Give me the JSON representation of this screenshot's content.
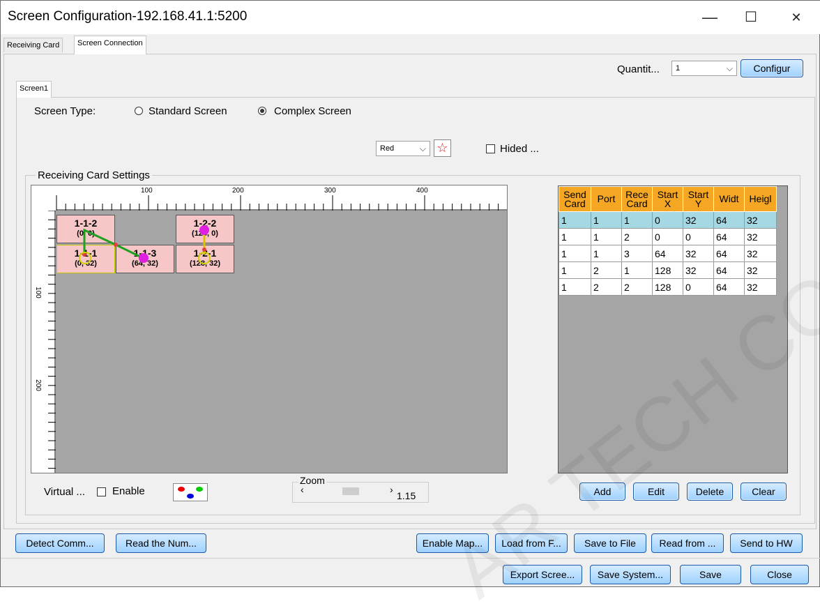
{
  "window": {
    "title": "Screen Configuration-192.168.41.1:5200",
    "minimize": "—",
    "maximize": "☐",
    "close": "✕"
  },
  "main_tabs": [
    "Receiving Card",
    "Screen Connection"
  ],
  "quantity": {
    "label": "Quantit...",
    "value": "1",
    "configure": "Configur"
  },
  "screen_tab": "Screen1",
  "screen_type": {
    "label": "Screen Type:",
    "standard": "Standard Screen",
    "complex": "Complex Screen"
  },
  "color_select": "Red",
  "hide_label": "Hided ...",
  "group_title": "Receiving Card Settings",
  "ruler": {
    "h": [
      "100",
      "200",
      "300",
      "400"
    ],
    "v": [
      "100",
      "200"
    ]
  },
  "cells": [
    {
      "name": "1-1-2",
      "coord": "(0, 0)"
    },
    {
      "name": "1-2-2",
      "coord": "(128, 0)"
    },
    {
      "name": "1-1-1",
      "coord": "(0, 32)"
    },
    {
      "name": "1-1-3",
      "coord": "(64, 32)"
    },
    {
      "name": "1-2-1",
      "coord": "(128, 32)"
    }
  ],
  "table": {
    "headers": [
      "Send Card",
      "Port",
      "Rece Card",
      "Start X",
      "Start Y",
      "Widt",
      "Heigl"
    ],
    "rows": [
      [
        "1",
        "1",
        "1",
        "0",
        "32",
        "64",
        "32"
      ],
      [
        "1",
        "1",
        "2",
        "0",
        "0",
        "64",
        "32"
      ],
      [
        "1",
        "1",
        "3",
        "64",
        "32",
        "64",
        "32"
      ],
      [
        "1",
        "2",
        "1",
        "128",
        "32",
        "64",
        "32"
      ],
      [
        "1",
        "2",
        "2",
        "128",
        "0",
        "64",
        "32"
      ]
    ]
  },
  "virtual": {
    "label": "Virtual ...",
    "enable": "Enable"
  },
  "zoom": {
    "label": "Zoom",
    "value": "1.15"
  },
  "table_buttons": [
    "Add",
    "Edit",
    "Delete",
    "Clear"
  ],
  "bottom1": [
    "Detect Comm...",
    "Read the Num...",
    "Enable Map...",
    "Load from F...",
    "Save to File",
    "Read from ...",
    "Send to HW"
  ],
  "bottom2": [
    "Export Scree...",
    "Save System...",
    "Save",
    "Close"
  ],
  "watermark": "AR TECH CO., LTD"
}
